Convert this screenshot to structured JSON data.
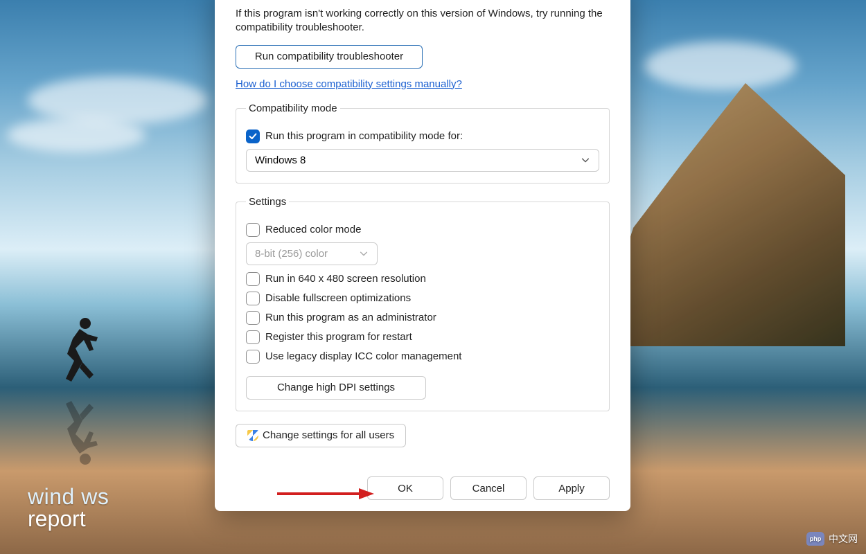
{
  "intro_text": "If this program isn't working correctly on this version of Windows, try running the compatibility troubleshooter.",
  "run_troubleshooter_label": "Run compatibility troubleshooter",
  "help_link": "How do I choose compatibility settings manually?",
  "compat_mode": {
    "legend": "Compatibility mode",
    "checkbox_label": "Run this program in compatibility mode for:",
    "checked": true,
    "selected_os": "Windows 8"
  },
  "settings": {
    "legend": "Settings",
    "reduced_color_label": "Reduced color mode",
    "reduced_color_value": "8-bit (256) color",
    "run_640x480_label": "Run in 640 x 480 screen resolution",
    "disable_fullscreen_label": "Disable fullscreen optimizations",
    "run_as_admin_label": "Run this program as an administrator",
    "register_restart_label": "Register this program for restart",
    "legacy_icc_label": "Use legacy display ICC color management",
    "change_dpi_label": "Change high DPI settings"
  },
  "change_all_users_label": "Change settings for all users",
  "buttons": {
    "ok": "OK",
    "cancel": "Cancel",
    "apply": "Apply"
  },
  "watermark": {
    "line1": "wind   ws",
    "line2": "report"
  },
  "phpcn_text": "中文网"
}
